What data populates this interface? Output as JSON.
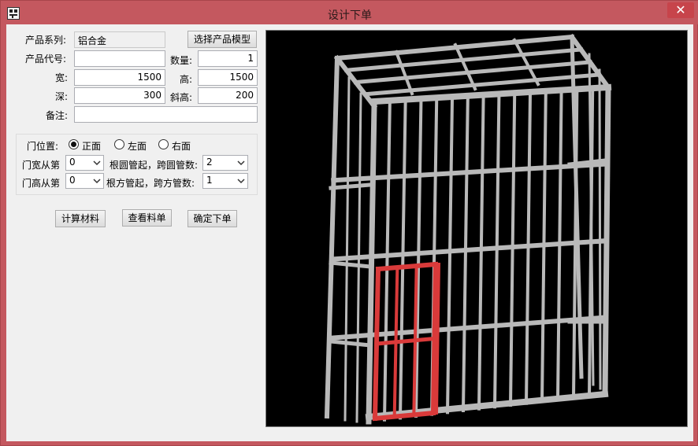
{
  "window": {
    "title": "设计下单",
    "close_glyph": "✕"
  },
  "form": {
    "series_label": "产品系列:",
    "series_value": "铝合金",
    "select_model_button": "选择产品模型",
    "code_label": "产品代号:",
    "code_value": "",
    "quantity_label": "数量:",
    "quantity_value": "1",
    "width_label": "宽:",
    "width_value": "1500",
    "height_label": "高:",
    "height_value": "1500",
    "depth_label": "深:",
    "depth_value": "300",
    "slant_label": "斜高:",
    "slant_value": "200",
    "note_label": "备注:",
    "note_value": ""
  },
  "door": {
    "position_label": "门位置:",
    "options": [
      {
        "label": "正面",
        "selected": true
      },
      {
        "label": "左面",
        "selected": false
      },
      {
        "label": "右面",
        "selected": false
      }
    ],
    "width_from_label": "门宽从第",
    "width_from_value": "0",
    "width_mid_label": "根圆管起，跨圆管数:",
    "width_span_value": "2",
    "height_from_label": "门高从第",
    "height_from_value": "0",
    "height_mid_label": "根方管起，跨方管数:",
    "height_span_value": "1"
  },
  "actions": {
    "calc_button": "计算材料",
    "view_button": "查看料单",
    "confirm_button": "确定下单"
  },
  "colors": {
    "frame": "#b9b9b9",
    "frame_edge": "#7a7a7a",
    "door": "#d93a3a"
  },
  "icons": {
    "app": "app-logo-icon",
    "close": "close-icon",
    "dropdown": "chevron-down-icon"
  }
}
